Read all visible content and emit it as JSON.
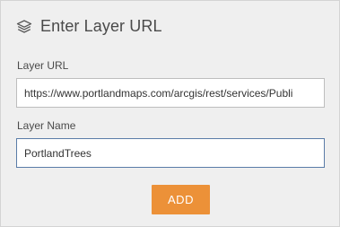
{
  "header": {
    "title": "Enter Layer URL",
    "icon": "layers-icon"
  },
  "form": {
    "url_label": "Layer URL",
    "url_value": "https://www.portlandmaps.com/arcgis/rest/services/Publi",
    "name_label": "Layer Name",
    "name_value": "PortlandTrees",
    "add_label": "ADD"
  },
  "colors": {
    "panel_bg": "#efefef",
    "accent": "#ec9138",
    "focus_border": "#5a7ca8"
  }
}
